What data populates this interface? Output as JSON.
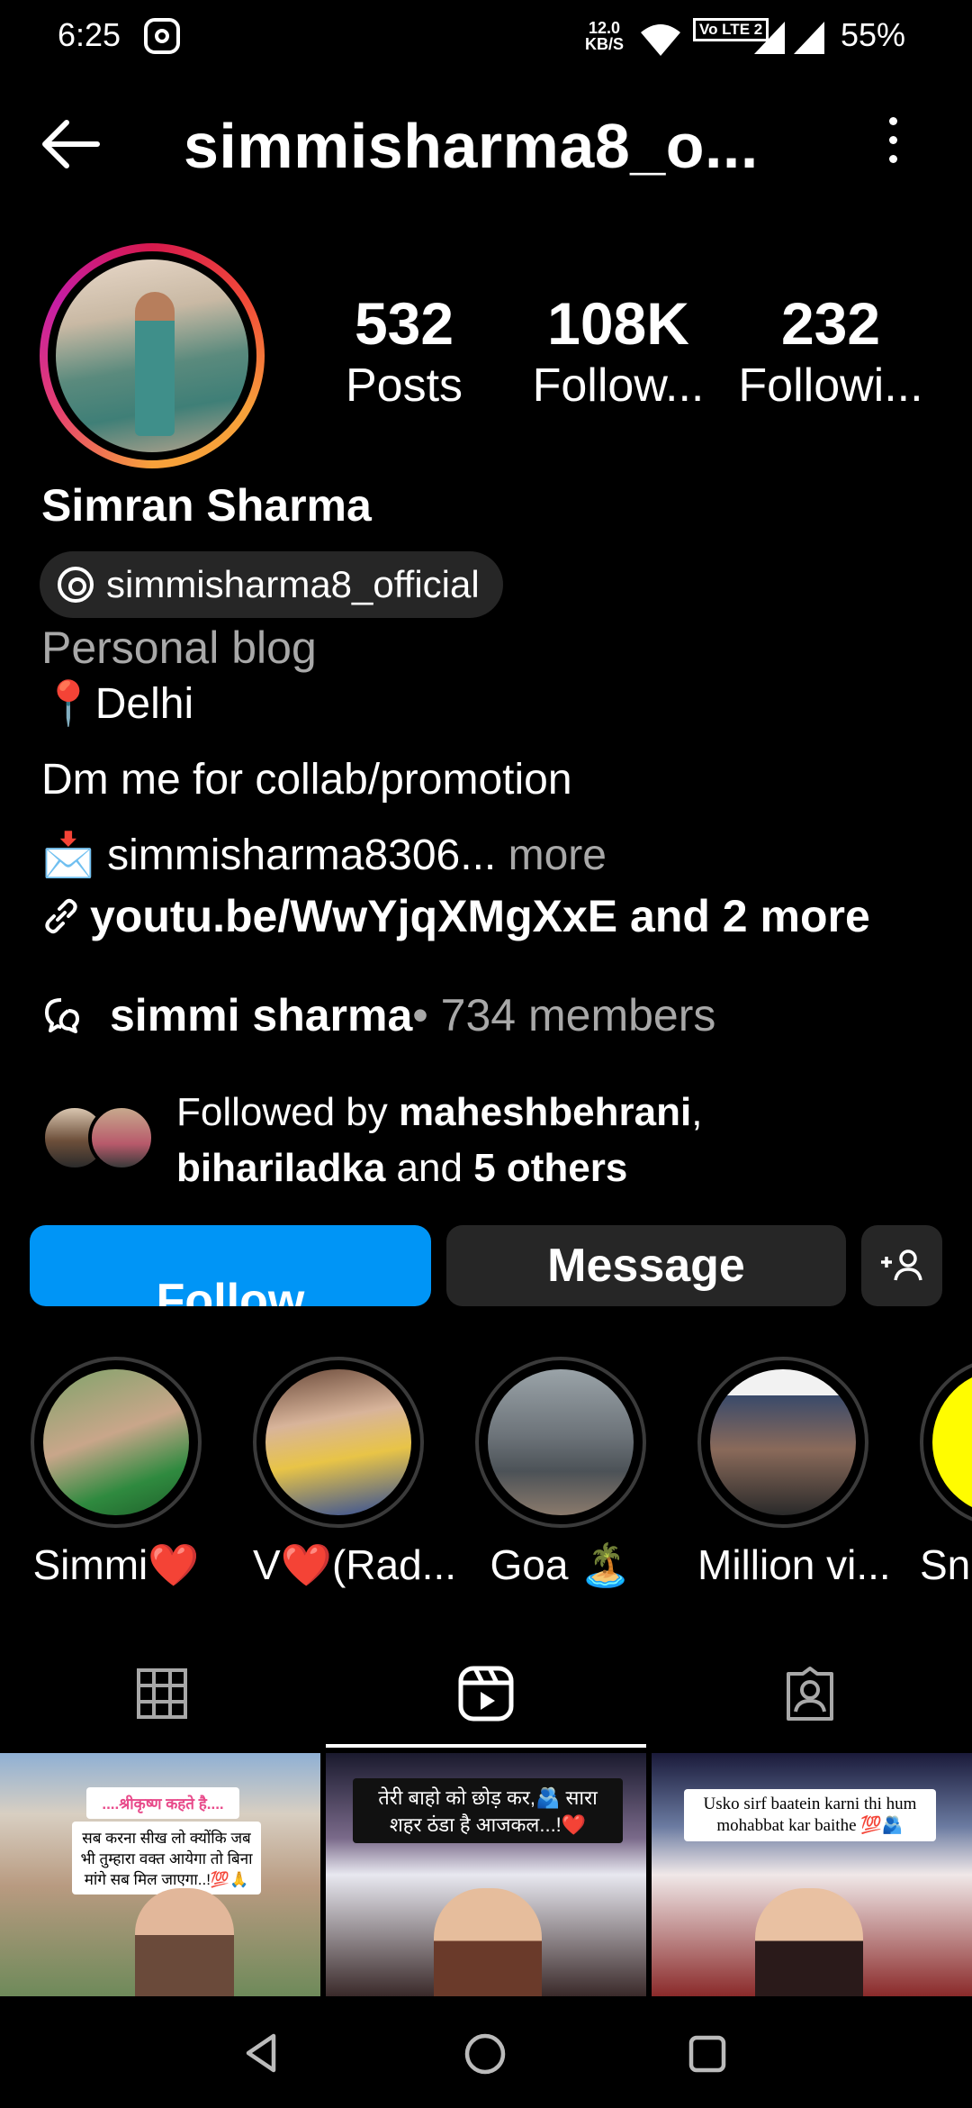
{
  "status_bar": {
    "time": "6:25",
    "net_speed": "12.0",
    "net_unit": "KB/S",
    "lte": "Vo LTE 2",
    "battery": "55%"
  },
  "header": {
    "username": "simmisharma8_o..."
  },
  "stats": {
    "posts": {
      "value": "532",
      "label": "Posts"
    },
    "followers": {
      "value": "108K",
      "label": "Follow..."
    },
    "following": {
      "value": "232",
      "label": "Followi..."
    }
  },
  "profile": {
    "name": "Simran Sharma",
    "threads_handle": "simmisharma8_official",
    "category": "Personal blog",
    "bio_line1": "📍Delhi",
    "bio_line2": "Dm me for collab/promotion",
    "bio_line3": "📩  simmisharma8306...",
    "bio_more": " more",
    "link": "youtu.be/WwYjqXMgXxE and 2 more",
    "channel_name": "simmi sharma",
    "channel_members": " • 734 members"
  },
  "followed_by": {
    "prefix": "Followed by ",
    "user1": "maheshbehrani",
    "sep": ",",
    "user2": "bihariladka",
    "mid": " and ",
    "others": "5 others"
  },
  "buttons": {
    "follow": "Follow",
    "message": "Message"
  },
  "highlights": [
    {
      "label": "Simmi❤️"
    },
    {
      "label": "V❤️(Rad..."
    },
    {
      "label": "Goa 🏝️"
    },
    {
      "label": "Million vi..."
    },
    {
      "label": "Sna"
    }
  ],
  "reels": [
    {
      "caption_title": "....श्रीकृष्ण कहते है....",
      "caption": "सब करना सीख लो क्योंकि जब भी तुम्हारा वक्त आयेगा तो बिना मांगे सब मिल जाएगा..!💯🙏"
    },
    {
      "caption": "तेरी बाहो को छोड़ कर,🫂 सारा शहर ठंडा है आजकल...!❤️"
    },
    {
      "caption": "Usko sirf baatein  karni thi hum mohabbat kar baithe 💯🫂"
    }
  ],
  "colors": {
    "follow_blue": "#0095f6",
    "button_gray": "#262626",
    "muted_text": "#a8a8a8"
  }
}
